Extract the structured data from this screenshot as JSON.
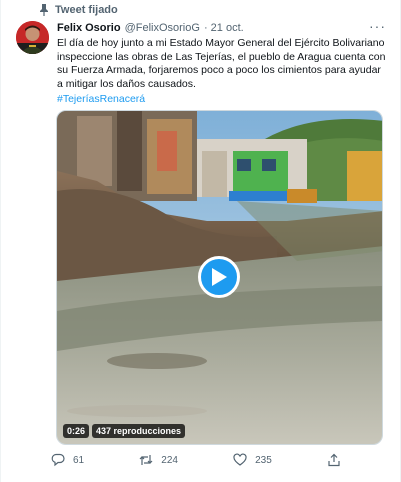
{
  "pinned_label": "Tweet fijado",
  "author": {
    "name": "Felix Osorio",
    "handle": "@FelixOsorioG",
    "date": "· 21 oct."
  },
  "tweet": {
    "text": "El día de hoy junto a mi Estado Mayor General del Ejército Bolivariano inspeccione las obras de Las Tejerías, el pueblo de Aragua cuenta con su Fuerza Armada, forjaremos poco a poco los cimientos para ayudar a mitigar los daños causados.",
    "hashtag": "#TejeríasRenacerá"
  },
  "video": {
    "duration": "0:26",
    "views": "437 reproducciones"
  },
  "actions": {
    "replies": "61",
    "retweets": "224",
    "likes": "235"
  },
  "colors": {
    "accent": "#1d9bf0",
    "muted": "#536471",
    "text": "#0f1419"
  }
}
